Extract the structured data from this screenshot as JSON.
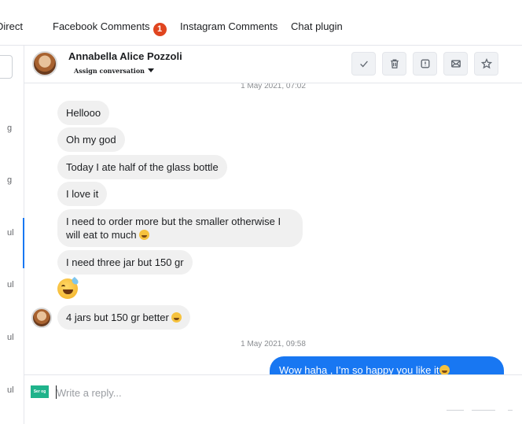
{
  "tabs": [
    {
      "label": "Direct",
      "visible": "Direct"
    },
    {
      "label": "Facebook Comments",
      "badge": "1"
    },
    {
      "label": "Instagram Comments"
    },
    {
      "label": "Chat plugin"
    }
  ],
  "left_list": {
    "fragments": [
      "g",
      "g",
      "ul",
      "ul",
      "ul",
      "ul"
    ]
  },
  "header": {
    "name": "Annabella Alice Pozzoli",
    "assign_label": "Assign conversation",
    "actions": [
      "check-icon",
      "trash-icon",
      "spam-icon",
      "envelope-icon",
      "star-icon"
    ]
  },
  "messages": [
    {
      "time": "1 May 2021, 07:02"
    },
    {
      "text": "Hellooo"
    },
    {
      "text": "Oh my god"
    },
    {
      "text": "Today I ate half of the glass bottle"
    },
    {
      "text": "I love it"
    },
    {
      "text": "I need to order more but the smaller otherwise I will eat to much",
      "emoji": "grinning-sweat-emoji"
    },
    {
      "text": "I need three jar  but 150 gr"
    },
    {
      "emoji": "grinning-sweat-emoji"
    },
    {
      "text": "4 jars but 150 gr better",
      "emoji": "grinning-sweat-emoji"
    },
    {
      "time": "1 May 2021, 09:58"
    },
    {
      "text": "Wow haha , I’m so happy you like it",
      "emoji": "grinning-sweat-emoji",
      "outgoing": true
    }
  ],
  "composer": {
    "placeholder": "Write a reply...",
    "logo_text": "Ser og"
  },
  "colors": {
    "accent": "#1877f2",
    "badge": "#e0451f",
    "incoming_bubble": "#f0f0f0",
    "brand_logo": "#1fb38b"
  }
}
